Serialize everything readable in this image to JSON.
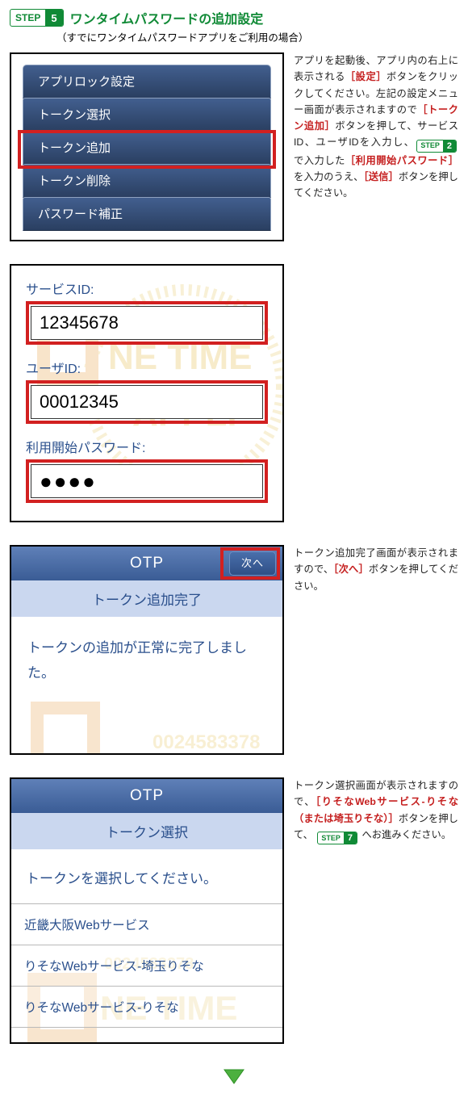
{
  "header": {
    "badge_word": "STEP",
    "badge_num": "5",
    "title": "ワンタイムパスワードの追加設定",
    "subtitle": "（すでにワンタイムパスワードアプリをご利用の場合）"
  },
  "panel1": {
    "items": [
      "アプリロック設定",
      "トークン選択",
      "トークン追加",
      "トークン削除",
      "パスワード補正"
    ],
    "highlight_index": 2,
    "note": {
      "t1": "アプリを起動後、アプリ内の右上に表示される",
      "hl1": "［設定］",
      "t2": "ボタンをクリックしてください。左記の設定メニュー画面が表示されますので",
      "hl2": "［トークン追加］",
      "t3": "ボタンを押して、サービスID、ユーザIDを入力し、",
      "step_badge_word": "STEP",
      "step_badge_num": "2",
      "t4": " で入力した",
      "hl3": "［利用開始パスワード］",
      "t5": "を入力のうえ、",
      "hl4": "［送信］",
      "t6": "ボタンを押してください。"
    }
  },
  "panel2": {
    "labels": {
      "service": "サービスID:",
      "user": "ユーザID:",
      "pw": "利用開始パスワード:"
    },
    "values": {
      "service": "12345678",
      "user": "00012345",
      "pw": "●●●●"
    }
  },
  "panel3": {
    "bar": "OTP",
    "next": "次へ",
    "sub": "トークン追加完了",
    "body": "トークンの追加が正常に完了しました。",
    "note": {
      "t1": "トークン追加完了画面が表示されますので、",
      "hl": "［次へ］",
      "t2": "ボタンを押してください。"
    }
  },
  "panel4": {
    "bar": "OTP",
    "sub": "トークン選択",
    "body": "トークンを選択してください。",
    "items": [
      "近畿大阪Webサービス",
      "りそなWebサービス-埼玉りそな",
      "りそなWebサービス-りそな"
    ],
    "note": {
      "t1": "トークン選択画面が表示されますので、",
      "hl": "［りそなWebサービス-りそな（または埼玉りそな）］",
      "t2": "ボタンを押して、 ",
      "step_badge_word": "STEP",
      "step_badge_num": "7",
      "t3": " へお進みください。"
    }
  }
}
